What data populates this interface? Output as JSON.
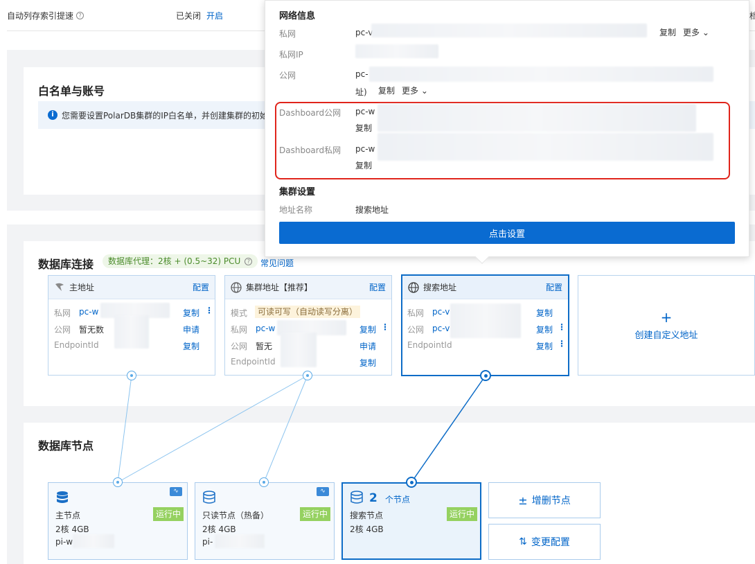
{
  "top": {
    "auto_index_label": "自动列存索引提速",
    "status_closed": "已关闭",
    "enable_link": "开启"
  },
  "whitelist": {
    "title": "白名单与账号",
    "notice": "您需要设置PolarDB集群的IP白名单，并创建集群的初始"
  },
  "db_connection": {
    "title": "数据库连接",
    "proxy_badge": "数据库代理：2核 + (0.5~32) PCU",
    "faq_link": "常见问题",
    "primary_endpoint": {
      "title": "主地址",
      "config": "配置",
      "private_label": "私网",
      "private_value": "pc-w",
      "public_label": "公网",
      "public_value": "暂无数",
      "endpoint_label": "EndpointId",
      "copy": "复制",
      "apply": "申请"
    },
    "cluster_endpoint": {
      "title": "集群地址【推荐】",
      "config": "配置",
      "mode_label": "模式",
      "mode_value": "可读可写（自动读写分离）",
      "private_label": "私网",
      "private_value": "pc-w",
      "public_label": "公网",
      "public_value": "暂无",
      "endpoint_label": "EndpointId",
      "copy": "复制",
      "apply": "申请"
    },
    "search_endpoint": {
      "title": "搜索地址",
      "config": "配置",
      "private_label": "私网",
      "private_value": "pc-v",
      "public_label": "公网",
      "public_value": "pc-v",
      "endpoint_label": "EndpointId",
      "copy": "复制"
    },
    "create_custom": {
      "plus": "+",
      "label": "创建自定义地址"
    }
  },
  "db_nodes": {
    "title": "数据库节点",
    "primary": {
      "name": "主节点",
      "spec": "2核 4GB",
      "id_prefix": "pi-w",
      "status": "运行中"
    },
    "readonly": {
      "name": "只读节点（热备）",
      "spec": "2核 4GB",
      "id_prefix": "pi-",
      "status": "运行中"
    },
    "search": {
      "count": "2",
      "count_unit": "个节点",
      "name": "搜索节点",
      "spec": "2核 4GB",
      "status": "运行中"
    },
    "add_remove_label": "增删节点",
    "change_config_label": "变更配置"
  },
  "popup": {
    "network_title": "网络信息",
    "private_label": "私网",
    "private_value": "pc-v",
    "private_ip_label": "私网IP",
    "public_label": "公网",
    "public_value": "pc-",
    "public_suffix": "址)",
    "copy": "复制",
    "more": "更多",
    "dashboard_public_label": "Dashboard公网",
    "dashboard_public_value": "pc-w",
    "dashboard_private_label": "Dashboard私网",
    "dashboard_private_value": "pc-w",
    "cluster_settings_title": "集群设置",
    "address_name_label": "地址名称",
    "address_name_value": "搜索地址",
    "setup_button": "点击设置"
  },
  "colors": {
    "accent": "#0064c8",
    "running": "#95d160",
    "highlight_border": "#e0241b"
  }
}
